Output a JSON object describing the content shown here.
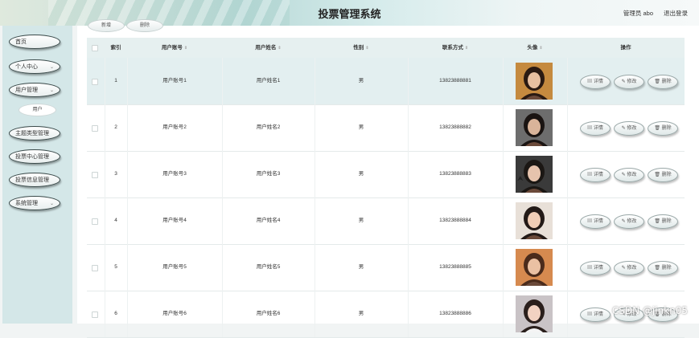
{
  "header": {
    "title": "投票管理系统",
    "user_info": "管理员 abo",
    "logout": "退出登录"
  },
  "sidebar": {
    "items": [
      {
        "label": "首页"
      },
      {
        "label": "个人中心",
        "chev": "⌄"
      },
      {
        "label": "用户管理",
        "chev": "⌄"
      },
      {
        "label": "主题类型管理"
      },
      {
        "label": "投票中心管理"
      },
      {
        "label": "投票信息管理"
      },
      {
        "label": "系统管理",
        "chev": "⌄"
      }
    ],
    "sub_item": "用户"
  },
  "toolbar": {
    "add_label": "新增",
    "delete_label": "删除"
  },
  "table": {
    "headers": {
      "index": "索引",
      "account": "用户账号",
      "name": "用户姓名",
      "gender": "性别",
      "phone": "联系方式",
      "avatar": "头像",
      "actions": "操作"
    },
    "sort_glyph": "⇕",
    "rows": [
      {
        "index": "1",
        "account": "用户账号1",
        "name": "用户姓名1",
        "gender": "男",
        "phone": "13823888881"
      },
      {
        "index": "2",
        "account": "用户账号2",
        "name": "用户姓名2",
        "gender": "男",
        "phone": "13823888882"
      },
      {
        "index": "3",
        "account": "用户账号3",
        "name": "用户姓名3",
        "gender": "男",
        "phone": "13823888883"
      },
      {
        "index": "4",
        "account": "用户账号4",
        "name": "用户姓名4",
        "gender": "男",
        "phone": "13823888884"
      },
      {
        "index": "5",
        "account": "用户账号5",
        "name": "用户姓名5",
        "gender": "男",
        "phone": "13823888885"
      },
      {
        "index": "6",
        "account": "用户账号6",
        "name": "用户姓名6",
        "gender": "男",
        "phone": "13823888886"
      }
    ],
    "actions": {
      "detail": "▤ 详情",
      "edit": "✎ 修改",
      "delete": "🗑 删除"
    }
  },
  "watermark": "CSDN @jinkn05",
  "colors": {
    "sidebar_bg": "#d4e7e8",
    "header_bg": "#e6f0f0",
    "highlight_row": "#e3eff0"
  }
}
